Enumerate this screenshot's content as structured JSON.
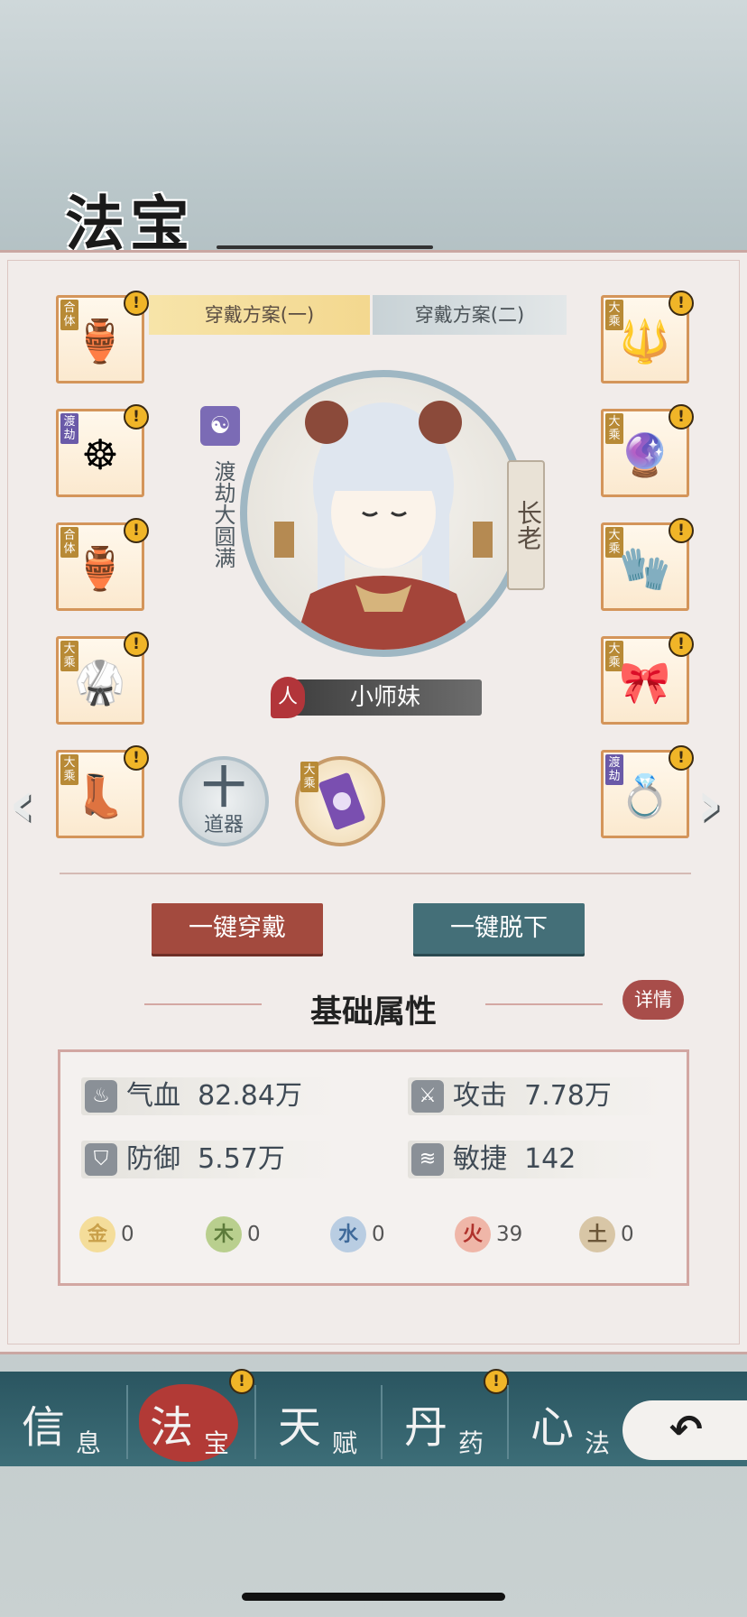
{
  "title": "法宝",
  "tabs": [
    "穿戴方案(一)",
    "穿戴方案(二)"
  ],
  "left_slots": [
    {
      "tag": "合体",
      "glyph": "🏺",
      "tag_color": "gold",
      "alert": "!"
    },
    {
      "tag": "渡劫",
      "glyph": "☸",
      "tag_color": "purple",
      "alert": "!"
    },
    {
      "tag": "合体",
      "glyph": "🏺",
      "tag_color": "gold",
      "alert": "!"
    },
    {
      "tag": "大乘",
      "glyph": "🥋",
      "tag_color": "gold",
      "alert": "!"
    },
    {
      "tag": "大乘",
      "glyph": "👢",
      "tag_color": "gold",
      "alert": "!"
    }
  ],
  "right_slots": [
    {
      "tag": "大乘",
      "glyph": "🔱",
      "tag_color": "gold",
      "alert": "!"
    },
    {
      "tag": "大乘",
      "glyph": "🔮",
      "tag_color": "gold",
      "alert": "!"
    },
    {
      "tag": "大乘",
      "glyph": "🧤",
      "tag_color": "gold",
      "alert": "!"
    },
    {
      "tag": "大乘",
      "glyph": "🎀",
      "tag_color": "gold",
      "alert": "!"
    },
    {
      "tag": "渡劫",
      "glyph": "💍",
      "tag_color": "purple",
      "alert": "!"
    }
  ],
  "character": {
    "realm": "渡劫大圆满",
    "rank": "长老",
    "race": "人",
    "name": "小师妹"
  },
  "daoqi_slot": {
    "plus": "十",
    "label": "道器"
  },
  "talisman_slot": {
    "tag": "大乘"
  },
  "buttons": {
    "equip_all": "一键穿戴",
    "unequip_all": "一键脱下",
    "details": "详情"
  },
  "attributes": {
    "title": "基础属性",
    "stats": [
      {
        "label": "气血",
        "value": "82.84万"
      },
      {
        "label": "攻击",
        "value": "7.78万"
      },
      {
        "label": "防御",
        "value": "5.57万"
      },
      {
        "label": "敏捷",
        "value": "142"
      }
    ],
    "elements": [
      {
        "name": "金",
        "value": "0",
        "color": "#c9a04a"
      },
      {
        "name": "木",
        "value": "0",
        "color": "#5c7a3a"
      },
      {
        "name": "水",
        "value": "0",
        "color": "#3f6a9a"
      },
      {
        "name": "火",
        "value": "39",
        "color": "#b0322c"
      },
      {
        "name": "土",
        "value": "0",
        "color": "#6b5638"
      }
    ]
  },
  "nav": [
    {
      "big": "信",
      "small": "息"
    },
    {
      "big": "法",
      "small": "宝",
      "alert": "!"
    },
    {
      "big": "天",
      "small": "赋"
    },
    {
      "big": "丹",
      "small": "药",
      "alert": "!"
    },
    {
      "big": "心",
      "small": "法"
    }
  ],
  "arrows": {
    "left": "‹",
    "right": "›"
  }
}
